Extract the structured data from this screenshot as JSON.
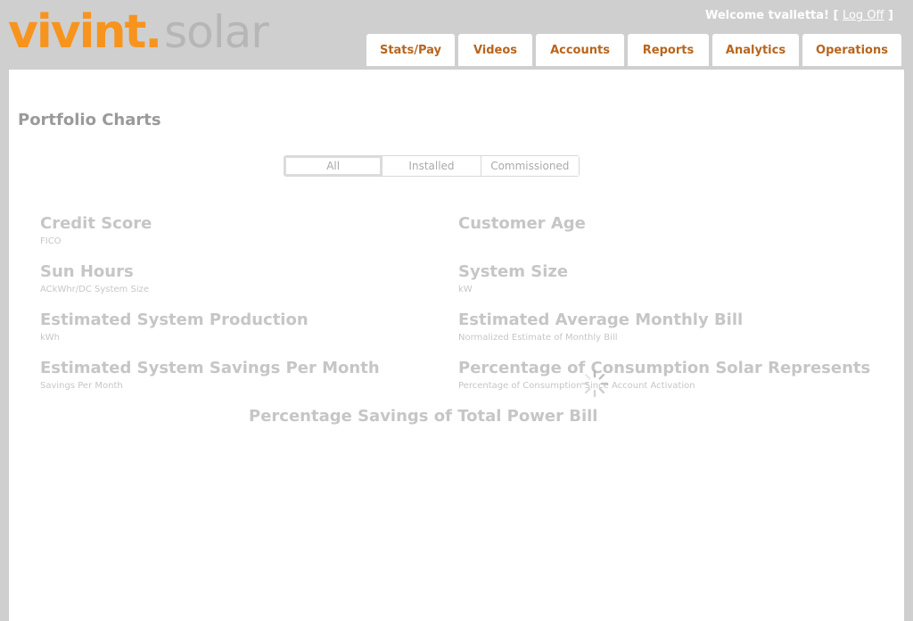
{
  "header": {
    "brand": "vivint.",
    "product": "solar",
    "welcome_text": "Welcome tvalletta!",
    "bracket_open": "[",
    "logoff_label": "Log Off",
    "bracket_close": "]"
  },
  "nav": {
    "tabs": [
      {
        "label": "Stats/Pay"
      },
      {
        "label": "Videos"
      },
      {
        "label": "Accounts"
      },
      {
        "label": "Reports"
      },
      {
        "label": "Analytics"
      },
      {
        "label": "Operations"
      }
    ]
  },
  "page": {
    "title": "Portfolio Charts",
    "filter": {
      "options": [
        "All",
        "Installed",
        "Commissioned"
      ],
      "selected": "All"
    },
    "charts": [
      {
        "title": "Credit Score",
        "subtitle": "FICO"
      },
      {
        "title": "Customer Age",
        "subtitle": ""
      },
      {
        "title": "Sun Hours",
        "subtitle": "ACkWhr/DC System Size"
      },
      {
        "title": "System Size",
        "subtitle": "kW"
      },
      {
        "title": "Estimated System Production",
        "subtitle": "kWh"
      },
      {
        "title": "Estimated Average Monthly Bill",
        "subtitle": "Normalized Estimate of Monthly Bill"
      },
      {
        "title": "Estimated System Savings Per Month",
        "subtitle": "Savings Per Month"
      },
      {
        "title": "Percentage of Consumption Solar Represents",
        "subtitle": "Percentage of Consumption Since Account Activation"
      },
      {
        "title": "Percentage Savings of Total Power Bill",
        "subtitle": ""
      }
    ]
  },
  "colors": {
    "brand_orange": "#f7941d",
    "tab_text": "#b8651d",
    "header_bg": "#cfcfcf"
  },
  "icons": {
    "loading": "loading-spinner-icon"
  }
}
